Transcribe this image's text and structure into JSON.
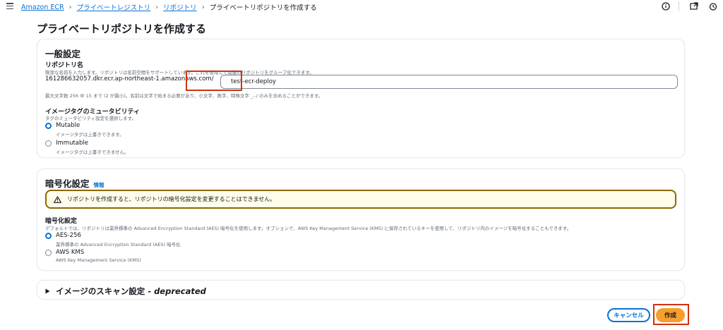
{
  "breadcrumb": {
    "items": [
      "Amazon ECR",
      "プライベートレジストリ",
      "リポジトリ"
    ],
    "current": "プライベートリポジトリを作成する"
  },
  "top_icons": [
    "info-circle-icon",
    "external-window-icon",
    "timer-icon"
  ],
  "page_title": "プライベートリポジトリを作成する",
  "general": {
    "header": "一般設定",
    "repo_name_label": "リポジトリ名",
    "repo_name_desc": "簡潔な名前を入力します。リポジトリは名前空間をサポートしています。これを使用して関連のリポジトリをグループ化できます。",
    "repo_prefix": "161286632057.dkr.ecr.ap-northeast-1.amazonaws.com/",
    "repo_name_value": "test-ecr-deploy",
    "repo_name_constraint": "最大文字数 256 中 15 まで (2 が最小)。名前は文字で始まる必要があり、小文字、数字、特殊文字 _-./ のみを含めることができます。",
    "mutability_label": "イメージタグのミュータビリティ",
    "mutability_desc": "タグのミュータビリティ設定を選択します。",
    "mutability_options": [
      {
        "label": "Mutable",
        "desc": "イメージタグは上書きできます。",
        "checked": true
      },
      {
        "label": "Immutable",
        "desc": "イメージタグは上書きできません。",
        "checked": false
      }
    ]
  },
  "encryption": {
    "header": "暗号化設定",
    "info": "情報",
    "alert": "リポジトリを作成すると、リポジトリの暗号化設定を変更することはできません。",
    "label": "暗号化設定",
    "desc": "デフォルトでは、リポジトリは業界標準の Advanced Encryption Standard (AES) 暗号化を使用します。オプションで、AWS Key Management Service (KMS) に保存されているキーを使用して、リポジトリ内のイメージを暗号化することもできます。",
    "options": [
      {
        "label": "AES-256",
        "desc": "業界標準の Advanced Encryption Standard (AES) 暗号化",
        "checked": true
      },
      {
        "label": "AWS KMS",
        "desc": "AWS Key Management Service (KMS)",
        "checked": false
      }
    ]
  },
  "scan": {
    "title": "イメージのスキャン設定 - ",
    "title_suffix": "deprecated"
  },
  "actions": {
    "cancel": "キャンセル",
    "create": "作成"
  },
  "colors": {
    "link": "#0972d3",
    "primary_button": "#f89e2c",
    "highlight": "#d13212",
    "warning_border": "#8d6605"
  }
}
